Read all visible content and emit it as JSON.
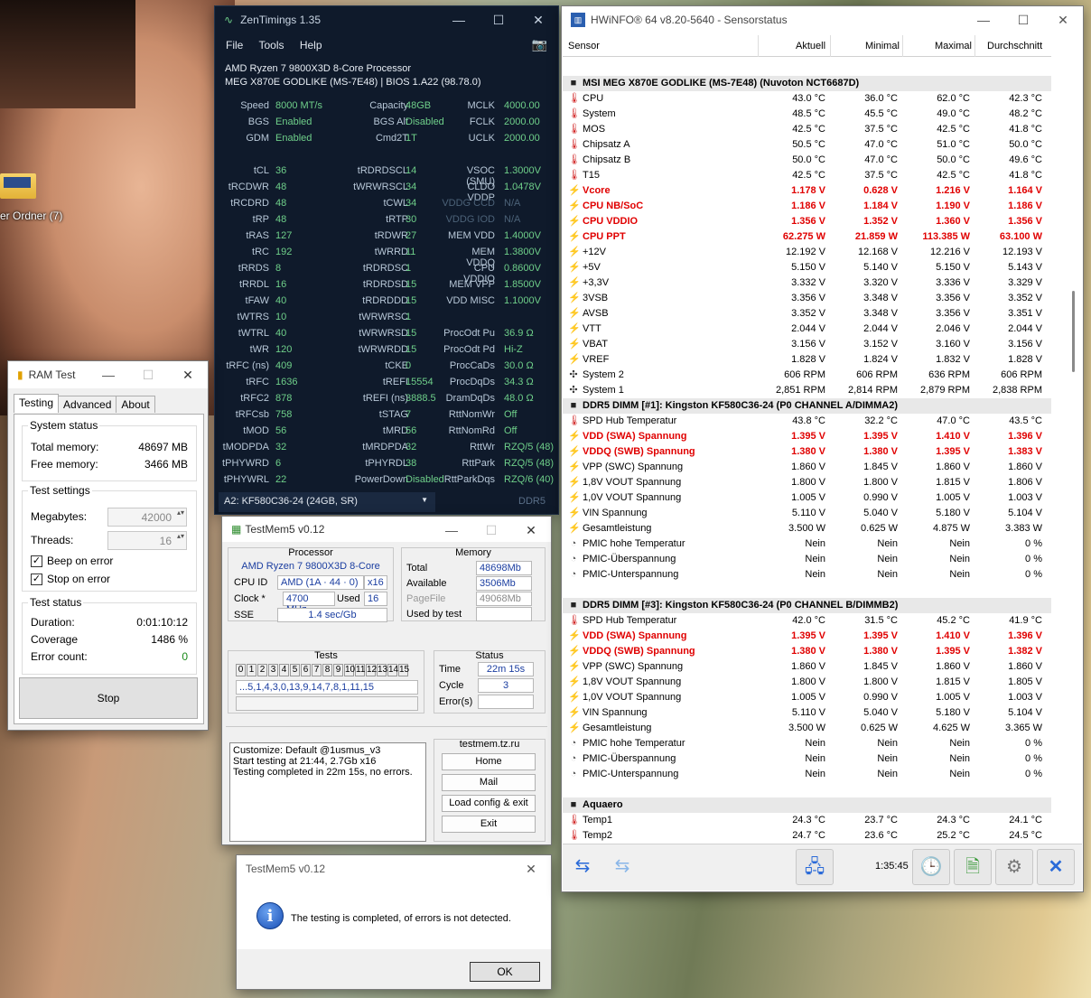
{
  "desktop": {
    "folder_label": "er Ordner (7)"
  },
  "zentimings": {
    "title": "ZenTimings 1.35",
    "menu": [
      "File",
      "Tools",
      "Help"
    ],
    "cpu": "AMD Ryzen 7 9800X3D 8-Core Processor",
    "board": "MEG X870E GODLIKE (MS-7E48) | BIOS 1.A22 (98.78.0)",
    "rows": [
      [
        "Speed",
        "8000 MT/s",
        "Capacity",
        "48GB",
        "MCLK",
        "4000.00"
      ],
      [
        "BGS",
        "Enabled",
        "BGS Alt",
        "Disabled",
        "FCLK",
        "2000.00"
      ],
      [
        "GDM",
        "Enabled",
        "Cmd2T",
        "1T",
        "UCLK",
        "2000.00"
      ],
      [
        "",
        "",
        "",
        "",
        "",
        ""
      ],
      [
        "tCL",
        "36",
        "tRDRDSCL",
        "14",
        "VSOC (SMU)",
        "1.3000V"
      ],
      [
        "tRCDWR",
        "48",
        "tWRWRSCL",
        "34",
        "CLDO VDDP",
        "1.0478V"
      ],
      [
        "tRCDRD",
        "48",
        "tCWL",
        "34",
        "VDDG CCD",
        "N/A"
      ],
      [
        "tRP",
        "48",
        "tRTP",
        "30",
        "VDDG IOD",
        "N/A"
      ],
      [
        "tRAS",
        "127",
        "tRDWR",
        "27",
        "MEM VDD",
        "1.4000V"
      ],
      [
        "tRC",
        "192",
        "tWRRD",
        "11",
        "MEM VDDQ",
        "1.3800V"
      ],
      [
        "tRRDS",
        "8",
        "tRDRDSC",
        "1",
        "CPU VDDIO",
        "0.8600V"
      ],
      [
        "tRRDL",
        "16",
        "tRDRDSD",
        "15",
        "MEM VPP",
        "1.8500V"
      ],
      [
        "tFAW",
        "40",
        "tRDRDDD",
        "15",
        "VDD MISC",
        "1.1000V"
      ],
      [
        "tWTRS",
        "10",
        "tWRWRSC",
        "1",
        "",
        ""
      ],
      [
        "tWTRL",
        "40",
        "tWRWRSD",
        "15",
        "ProcOdt Pu",
        "36.9 Ω"
      ],
      [
        "tWR",
        "120",
        "tWRWRDD",
        "15",
        "ProcOdt Pd",
        "Hi-Z"
      ],
      [
        "tRFC (ns)",
        "409",
        "tCKE",
        "0",
        "ProcCaDs",
        "30.0 Ω"
      ],
      [
        "tRFC",
        "1636",
        "tREFI",
        "15554",
        "ProcDqDs",
        "34.3 Ω"
      ],
      [
        "tRFC2",
        "878",
        "tREFI (ns)",
        "3888.5",
        "DramDqDs",
        "48.0 Ω"
      ],
      [
        "tRFCsb",
        "758",
        "tSTAG",
        "7",
        "RttNomWr",
        "Off"
      ],
      [
        "tMOD",
        "56",
        "tMRD",
        "56",
        "RttNomRd",
        "Off"
      ],
      [
        "tMODPDA",
        "32",
        "tMRDPDA",
        "32",
        "RttWr",
        "RZQ/5 (48)"
      ],
      [
        "tPHYWRD",
        "6",
        "tPHYRDL",
        "38",
        "RttPark",
        "RZQ/5 (48)"
      ],
      [
        "tPHYWRL",
        "22",
        "PowerDown",
        "Disabled",
        "RttParkDqs",
        "RZQ/6 (40)"
      ]
    ],
    "dim_values": [
      "N/A"
    ],
    "module_select": "A2: KF580C36-24 (24GB, SR)",
    "ddr_label": "DDR5"
  },
  "ramtest": {
    "title": "RAM Test",
    "tabs": [
      "Testing",
      "Advanced",
      "About"
    ],
    "system_status": "System status",
    "total_memory_label": "Total memory:",
    "total_memory": "48697 MB",
    "free_memory_label": "Free memory:",
    "free_memory": "3466 MB",
    "test_settings": "Test settings",
    "megabytes_label": "Megabytes:",
    "megabytes": "42000",
    "threads_label": "Threads:",
    "threads": "16",
    "beep_label": "Beep on error",
    "stop_label": "Stop on error",
    "test_status": "Test status",
    "duration_label": "Duration:",
    "duration": "0:01:10:12",
    "coverage_label": "Coverage",
    "coverage": "1486 %",
    "errors_label": "Error count:",
    "errors": "0",
    "stop_button": "Stop"
  },
  "testmem": {
    "title": "TestMem5 v0.12",
    "processor_header": "Processor",
    "memory_header": "Memory",
    "cpu_name": "AMD Ryzen 7 9800X3D 8-Core",
    "cpu_id_label": "CPU ID",
    "cpu_id": "AMD  (1A · 44 · 0)",
    "cpu_x": "x16",
    "clock_label": "Clock *",
    "clock": "4700 MHz",
    "used_label": "Used",
    "used": "16",
    "sse_label": "SSE",
    "sse": "1.4 sec/Gb",
    "total_label": "Total",
    "total": "48698Mb",
    "available_label": "Available",
    "available": "3506Mb",
    "pagefile_label": "PageFile",
    "pagefile": "49068Mb",
    "usedbytest_label": "Used by test",
    "usedbytest": "",
    "tests_header": "Tests",
    "test_numbers": [
      "0",
      "1",
      "2",
      "3",
      "4",
      "5",
      "6",
      "7",
      "8",
      "9",
      "10",
      "11",
      "12",
      "13",
      "14",
      "15"
    ],
    "test_sequence": "...5,1,4,3,0,13,9,14,7,8,1,11,15",
    "status_header": "Status",
    "time_label": "Time",
    "time": "22m 15s",
    "cycle_label": "Cycle",
    "cycle": "3",
    "errors_label": "Error(s)",
    "errors": "",
    "log_lines": [
      "Customize: Default @1usmus_v3",
      "Start testing at 21:44, 2.7Gb x16",
      "Testing completed in 22m 15s, no errors."
    ],
    "site": "testmem.tz.ru",
    "buttons": [
      "Home",
      "Mail",
      "Load config & exit",
      "Exit"
    ]
  },
  "dialog": {
    "title": "TestMem5 v0.12",
    "message": "The testing is completed, of errors is not detected.",
    "ok": "OK"
  },
  "hwinfo": {
    "title": "HWiNFO® 64 v8.20-5640 - Sensorstatus",
    "columns": [
      "Sensor",
      "Aktuell",
      "Minimal",
      "Maximal",
      "Durchschnitt"
    ],
    "rows": [
      {
        "t": "blank"
      },
      {
        "t": "grp",
        "n": "MSI MEG X870E GODLIKE (MS-7E48) (Nuvoton NCT6687D)"
      },
      {
        "i": "therm",
        "n": "CPU",
        "v": [
          "43.0 °C",
          "36.0 °C",
          "62.0 °C",
          "42.3 °C"
        ]
      },
      {
        "i": "therm",
        "n": "System",
        "v": [
          "48.5 °C",
          "45.5 °C",
          "49.0 °C",
          "48.2 °C"
        ]
      },
      {
        "i": "therm",
        "n": "MOS",
        "v": [
          "42.5 °C",
          "37.5 °C",
          "42.5 °C",
          "41.8 °C"
        ]
      },
      {
        "i": "therm",
        "n": "Chipsatz A",
        "v": [
          "50.5 °C",
          "47.0 °C",
          "51.0 °C",
          "50.0 °C"
        ]
      },
      {
        "i": "therm",
        "n": "Chipsatz B",
        "v": [
          "50.0 °C",
          "47.0 °C",
          "50.0 °C",
          "49.6 °C"
        ]
      },
      {
        "i": "therm",
        "n": "T15",
        "v": [
          "42.5 °C",
          "37.5 °C",
          "42.5 °C",
          "41.8 °C"
        ]
      },
      {
        "i": "volt",
        "n": "Vcore",
        "v": [
          "1.178 V",
          "0.628 V",
          "1.216 V",
          "1.164 V"
        ],
        "red": true
      },
      {
        "i": "volt",
        "n": "CPU NB/SoC",
        "v": [
          "1.186 V",
          "1.184 V",
          "1.190 V",
          "1.186 V"
        ],
        "red": true
      },
      {
        "i": "volt",
        "n": "CPU VDDIO",
        "v": [
          "1.356 V",
          "1.352 V",
          "1.360 V",
          "1.356 V"
        ],
        "red": true
      },
      {
        "i": "volt",
        "n": "CPU PPT",
        "v": [
          "62.275 W",
          "21.859 W",
          "113.385 W",
          "63.100 W"
        ],
        "red": true
      },
      {
        "i": "volt",
        "n": "+12V",
        "v": [
          "12.192 V",
          "12.168 V",
          "12.216 V",
          "12.193 V"
        ]
      },
      {
        "i": "volt",
        "n": "+5V",
        "v": [
          "5.150 V",
          "5.140 V",
          "5.150 V",
          "5.143 V"
        ]
      },
      {
        "i": "volt",
        "n": "+3,3V",
        "v": [
          "3.332 V",
          "3.320 V",
          "3.336 V",
          "3.329 V"
        ]
      },
      {
        "i": "volt",
        "n": "3VSB",
        "v": [
          "3.356 V",
          "3.348 V",
          "3.356 V",
          "3.352 V"
        ]
      },
      {
        "i": "volt",
        "n": "AVSB",
        "v": [
          "3.352 V",
          "3.348 V",
          "3.356 V",
          "3.351 V"
        ]
      },
      {
        "i": "volt",
        "n": "VTT",
        "v": [
          "2.044 V",
          "2.044 V",
          "2.046 V",
          "2.044 V"
        ]
      },
      {
        "i": "volt",
        "n": "VBAT",
        "v": [
          "3.156 V",
          "3.152 V",
          "3.160 V",
          "3.156 V"
        ]
      },
      {
        "i": "volt",
        "n": "VREF",
        "v": [
          "1.828 V",
          "1.824 V",
          "1.832 V",
          "1.828 V"
        ]
      },
      {
        "i": "fan",
        "n": "System 2",
        "v": [
          "606 RPM",
          "606 RPM",
          "636 RPM",
          "606 RPM"
        ]
      },
      {
        "i": "fan",
        "n": "System 1",
        "v": [
          "2,851 RPM",
          "2,814 RPM",
          "2,879 RPM",
          "2,838 RPM"
        ]
      },
      {
        "t": "grp",
        "n": "DDR5 DIMM [#1]: Kingston KF580C36-24 (P0 CHANNEL A/DIMMA2)"
      },
      {
        "i": "therm",
        "n": "SPD Hub Temperatur",
        "v": [
          "43.8 °C",
          "32.2 °C",
          "47.0 °C",
          "43.5 °C"
        ]
      },
      {
        "i": "volt",
        "n": "VDD (SWA) Spannung",
        "v": [
          "1.395 V",
          "1.395 V",
          "1.410 V",
          "1.396 V"
        ],
        "red": true
      },
      {
        "i": "volt",
        "n": "VDDQ (SWB) Spannung",
        "v": [
          "1.380 V",
          "1.380 V",
          "1.395 V",
          "1.383 V"
        ],
        "red": true
      },
      {
        "i": "volt",
        "n": "VPP (SWC) Spannung",
        "v": [
          "1.860 V",
          "1.845 V",
          "1.860 V",
          "1.860 V"
        ]
      },
      {
        "i": "volt",
        "n": "1,8V VOUT Spannung",
        "v": [
          "1.800 V",
          "1.800 V",
          "1.815 V",
          "1.806 V"
        ]
      },
      {
        "i": "volt",
        "n": "1,0V VOUT Spannung",
        "v": [
          "1.005 V",
          "0.990 V",
          "1.005 V",
          "1.003 V"
        ]
      },
      {
        "i": "volt",
        "n": "VIN Spannung",
        "v": [
          "5.110 V",
          "5.040 V",
          "5.180 V",
          "5.104 V"
        ]
      },
      {
        "i": "volt",
        "n": "Gesamtleistung",
        "v": [
          "3.500 W",
          "0.625 W",
          "4.875 W",
          "3.383 W"
        ]
      },
      {
        "i": "clk",
        "n": "PMIC hohe Temperatur",
        "v": [
          "Nein",
          "Nein",
          "Nein",
          "0 %"
        ]
      },
      {
        "i": "clk",
        "n": "PMIC-Überspannung",
        "v": [
          "Nein",
          "Nein",
          "Nein",
          "0 %"
        ]
      },
      {
        "i": "clk",
        "n": "PMIC-Unterspannung",
        "v": [
          "Nein",
          "Nein",
          "Nein",
          "0 %"
        ]
      },
      {
        "t": "blank"
      },
      {
        "t": "grp",
        "n": "DDR5 DIMM [#3]: Kingston KF580C36-24 (P0 CHANNEL B/DIMMB2)"
      },
      {
        "i": "therm",
        "n": "SPD Hub Temperatur",
        "v": [
          "42.0 °C",
          "31.5 °C",
          "45.2 °C",
          "41.9 °C"
        ]
      },
      {
        "i": "volt",
        "n": "VDD (SWA) Spannung",
        "v": [
          "1.395 V",
          "1.395 V",
          "1.410 V",
          "1.396 V"
        ],
        "red": true
      },
      {
        "i": "volt",
        "n": "VDDQ (SWB) Spannung",
        "v": [
          "1.380 V",
          "1.380 V",
          "1.395 V",
          "1.382 V"
        ],
        "red": true
      },
      {
        "i": "volt",
        "n": "VPP (SWC) Spannung",
        "v": [
          "1.860 V",
          "1.845 V",
          "1.860 V",
          "1.860 V"
        ]
      },
      {
        "i": "volt",
        "n": "1,8V VOUT Spannung",
        "v": [
          "1.800 V",
          "1.800 V",
          "1.815 V",
          "1.805 V"
        ]
      },
      {
        "i": "volt",
        "n": "1,0V VOUT Spannung",
        "v": [
          "1.005 V",
          "0.990 V",
          "1.005 V",
          "1.003 V"
        ]
      },
      {
        "i": "volt",
        "n": "VIN Spannung",
        "v": [
          "5.110 V",
          "5.040 V",
          "5.180 V",
          "5.104 V"
        ]
      },
      {
        "i": "volt",
        "n": "Gesamtleistung",
        "v": [
          "3.500 W",
          "0.625 W",
          "4.625 W",
          "3.365 W"
        ]
      },
      {
        "i": "clk",
        "n": "PMIC hohe Temperatur",
        "v": [
          "Nein",
          "Nein",
          "Nein",
          "0 %"
        ]
      },
      {
        "i": "clk",
        "n": "PMIC-Überspannung",
        "v": [
          "Nein",
          "Nein",
          "Nein",
          "0 %"
        ]
      },
      {
        "i": "clk",
        "n": "PMIC-Unterspannung",
        "v": [
          "Nein",
          "Nein",
          "Nein",
          "0 %"
        ]
      },
      {
        "t": "blank"
      },
      {
        "t": "grp",
        "n": "Aquaero",
        "sq": true
      },
      {
        "i": "therm",
        "n": "Temp1",
        "v": [
          "24.3 °C",
          "23.7 °C",
          "24.3 °C",
          "24.1 °C"
        ]
      },
      {
        "i": "therm",
        "n": "Temp2",
        "v": [
          "24.7 °C",
          "23.6 °C",
          "25.2 °C",
          "24.5 °C"
        ]
      }
    ],
    "clock": "1:35:45",
    "accent_red": "#e00000"
  }
}
